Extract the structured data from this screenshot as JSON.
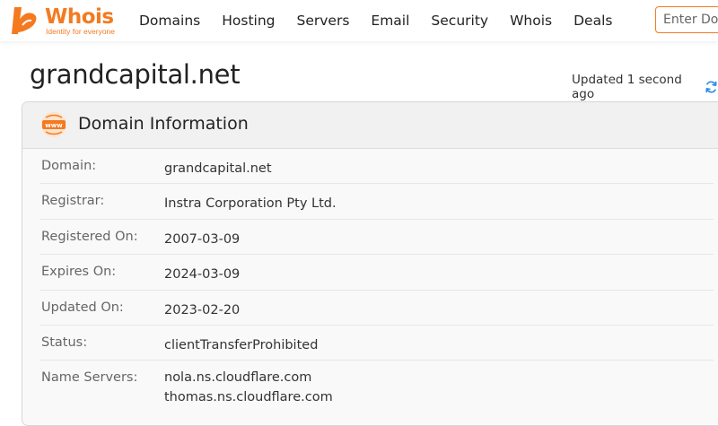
{
  "header": {
    "logo_text": "Whois",
    "logo_tagline": "Identity for everyone",
    "nav": [
      "Domains",
      "Hosting",
      "Servers",
      "Email",
      "Security",
      "Whois",
      "Deals"
    ],
    "search_placeholder": "Enter Domain"
  },
  "page": {
    "domain": "grandcapital.net",
    "updated_text": "Updated 1 second ago"
  },
  "card": {
    "title": "Domain Information",
    "rows": [
      {
        "label": "Domain:",
        "value": "grandcapital.net"
      },
      {
        "label": "Registrar:",
        "value": "Instra Corporation Pty Ltd."
      },
      {
        "label": "Registered On:",
        "value": "2007-03-09"
      },
      {
        "label": "Expires On:",
        "value": "2024-03-09"
      },
      {
        "label": "Updated On:",
        "value": "2023-02-20"
      },
      {
        "label": "Status:",
        "value": "clientTransferProhibited"
      }
    ],
    "name_servers": {
      "label": "Name Servers:",
      "values": [
        "nola.ns.cloudflare.com",
        "thomas.ns.cloudflare.com"
      ]
    }
  },
  "colors": {
    "brand_orange": "#f47a20",
    "refresh_blue": "#2e8de6"
  }
}
